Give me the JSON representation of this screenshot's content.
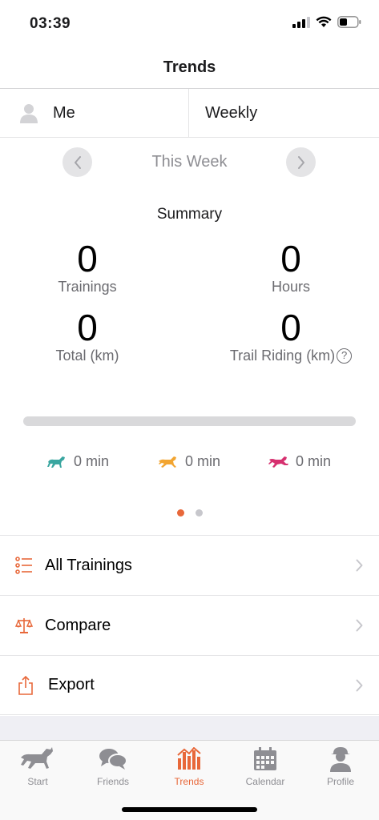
{
  "status_bar": {
    "time": "03:39"
  },
  "nav": {
    "title": "Trends"
  },
  "selector": {
    "user": "Me",
    "period_type": "Weekly"
  },
  "period": {
    "label": "This Week"
  },
  "summary": {
    "title": "Summary",
    "trainings": {
      "value": "0",
      "label": "Trainings"
    },
    "hours": {
      "value": "0",
      "label": "Hours"
    },
    "total": {
      "value": "0",
      "label": "Total (km)"
    },
    "trail": {
      "value": "0",
      "label": "Trail Riding (km)"
    }
  },
  "progress": {
    "fraction": 0
  },
  "gaits": [
    {
      "value": "0 min",
      "color": "#3aa6a0",
      "icon": "horse-walk-icon"
    },
    {
      "value": "0 min",
      "color": "#f2a531",
      "icon": "horse-trot-icon"
    },
    {
      "value": "0 min",
      "color": "#d6306f",
      "icon": "horse-gallop-icon"
    }
  ],
  "pager": {
    "page": 1,
    "pages": 2
  },
  "menu": {
    "all_trainings": "All Trainings",
    "compare": "Compare",
    "export": "Export"
  },
  "tabs": {
    "start": "Start",
    "friends": "Friends",
    "trends": "Trends",
    "calendar": "Calendar",
    "profile": "Profile"
  },
  "colors": {
    "accent": "#e8683a",
    "inactive": "#8e8e93"
  }
}
